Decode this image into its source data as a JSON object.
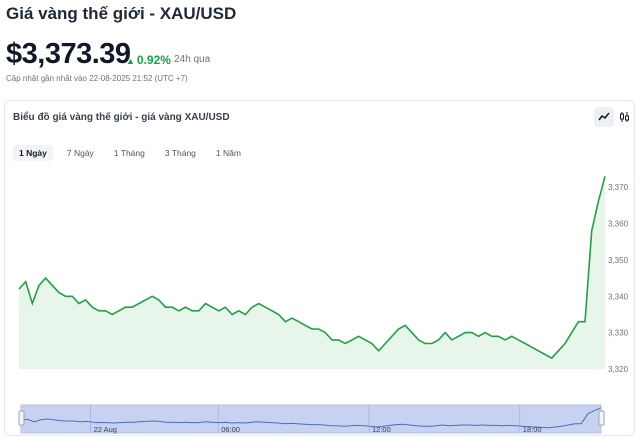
{
  "header": {
    "title": "Giá vàng thế giới - XAU/USD",
    "price": "$3,373.39",
    "change": "0.92%",
    "period": "24h qua",
    "updated": "Cập nhật gần nhất vào 22-08-2025 21:52 (UTC +7)"
  },
  "card": {
    "title": "Biểu đồ giá vàng thế giới - giá vàng XAU/USD",
    "tabs": [
      {
        "label": "1 Ngày",
        "active": true
      },
      {
        "label": "7 Ngày",
        "active": false
      },
      {
        "label": "1 Tháng",
        "active": false
      },
      {
        "label": "3 Tháng",
        "active": false
      },
      {
        "label": "1 Năm",
        "active": false
      }
    ]
  },
  "colors": {
    "up": "#16a34a",
    "line": "#22a046",
    "fill": "#e8f5ea",
    "nav": "#c7d2f0"
  },
  "chart_data": {
    "type": "area",
    "ylim": [
      3320,
      3375
    ],
    "yticks": [
      "3,320",
      "3,330",
      "3,340",
      "3,350",
      "3,360",
      "3,370"
    ],
    "xticks": [
      "22 Aug",
      "06:00",
      "12:00",
      "18:00"
    ],
    "values": [
      3342,
      3344,
      3338,
      3343,
      3345,
      3343,
      3341,
      3340,
      3340,
      3338,
      3339,
      3337,
      3336,
      3336,
      3335,
      3336,
      3337,
      3337,
      3338,
      3339,
      3340,
      3339,
      3337,
      3337,
      3336,
      3337,
      3336,
      3336,
      3338,
      3337,
      3336,
      3337,
      3335,
      3336,
      3335,
      3337,
      3338,
      3337,
      3336,
      3335,
      3333,
      3334,
      3333,
      3332,
      3331,
      3331,
      3330,
      3328,
      3328,
      3327,
      3328,
      3329,
      3328,
      3327,
      3325,
      3327,
      3329,
      3331,
      3332,
      3330,
      3328,
      3327,
      3327,
      3328,
      3330,
      3328,
      3329,
      3330,
      3330,
      3329,
      3330,
      3329,
      3329,
      3328,
      3329,
      3328,
      3327,
      3326,
      3325,
      3324,
      3323,
      3325,
      3327,
      3330,
      3333,
      3333,
      3358,
      3366,
      3373
    ]
  }
}
